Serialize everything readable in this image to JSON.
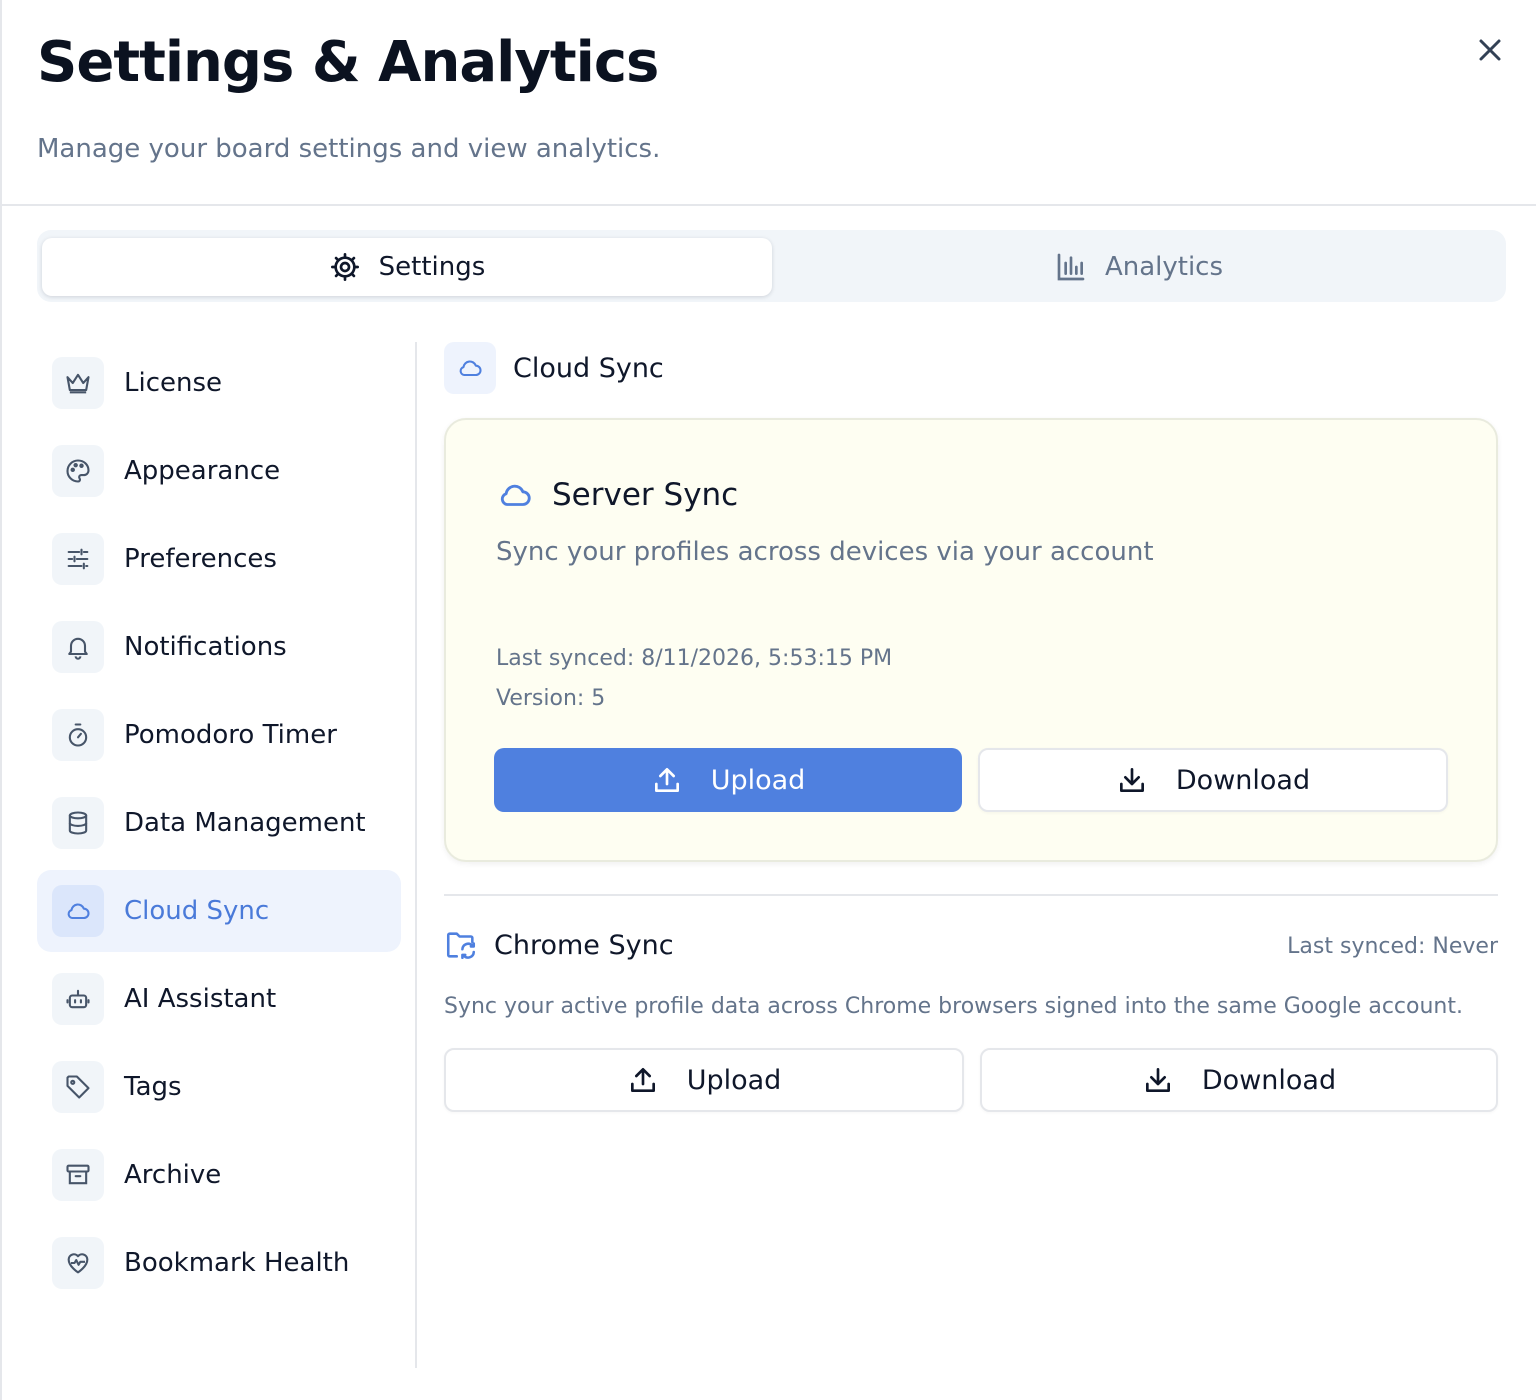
{
  "header": {
    "title": "Settings & Analytics",
    "subtitle": "Manage your board settings and view analytics.",
    "close_icon": "x-close-icon"
  },
  "tabs": [
    {
      "label": "Settings",
      "icon": "gear-icon",
      "active": true
    },
    {
      "label": "Analytics",
      "icon": "bar-chart-icon",
      "active": false
    }
  ],
  "sidebar": {
    "items": [
      {
        "label": "License",
        "icon": "crown-icon"
      },
      {
        "label": "Appearance",
        "icon": "palette-icon"
      },
      {
        "label": "Preferences",
        "icon": "sliders-icon"
      },
      {
        "label": "Notifications",
        "icon": "bell-icon"
      },
      {
        "label": "Pomodoro Timer",
        "icon": "timer-icon"
      },
      {
        "label": "Data Management",
        "icon": "database-icon"
      },
      {
        "label": "Cloud Sync",
        "icon": "cloud-icon",
        "active": true
      },
      {
        "label": "AI Assistant",
        "icon": "bot-icon"
      },
      {
        "label": "Tags",
        "icon": "tag-icon"
      },
      {
        "label": "Archive",
        "icon": "archive-icon"
      },
      {
        "label": "Bookmark Health",
        "icon": "heart-pulse-icon"
      }
    ]
  },
  "main": {
    "section_title": "Cloud Sync",
    "server_sync": {
      "title": "Server Sync",
      "description": "Sync your profiles across devices via your account",
      "last_synced": "Last synced: 8/11/2026, 5:53:15 PM",
      "version": "Version: 5",
      "upload_label": "Upload",
      "download_label": "Download"
    },
    "chrome_sync": {
      "title": "Chrome Sync",
      "last_synced": "Last synced: Never",
      "description": "Sync your active profile data across Chrome browsers signed into the same Google account.",
      "upload_label": "Upload",
      "download_label": "Download"
    }
  },
  "colors": {
    "accent": "#4f80df",
    "active_nav_bg": "#eef3fd",
    "card_bg": "#fefef2",
    "muted_text": "#64748b"
  }
}
